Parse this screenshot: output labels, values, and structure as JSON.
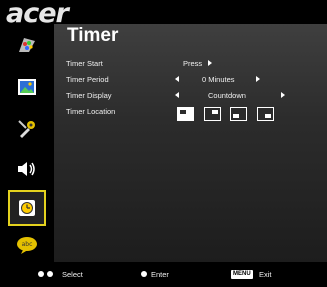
{
  "brand": {
    "logo": "acer"
  },
  "menu": {
    "title": "Timer",
    "items": [
      {
        "label": "Timer Start",
        "value": "Press"
      },
      {
        "label": "Timer Period",
        "value": "0 Minutes"
      },
      {
        "label": "Timer Display",
        "value": "Countdown"
      },
      {
        "label": "Timer Location"
      }
    ],
    "location_options": [
      "top-left",
      "top-right",
      "bottom-left",
      "bottom-right"
    ],
    "selected_location": "top-left"
  },
  "sidebar": {
    "icons": [
      "color-icon",
      "image-icon",
      "settings-icon",
      "audio-icon",
      "timer-icon",
      "language-icon"
    ],
    "selected": "timer-icon"
  },
  "footer": {
    "select_label": "Select",
    "enter_label": "Enter",
    "menu_key": "MENU",
    "exit_label": "Exit"
  },
  "colors": {
    "highlight": "#e4d21e"
  }
}
